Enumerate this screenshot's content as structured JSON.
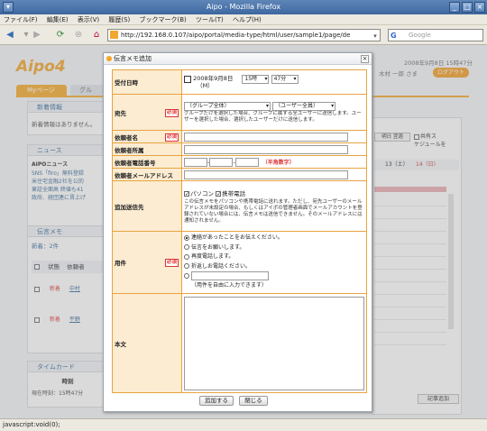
{
  "window": {
    "title": "Aipo - Mozilla Firefox"
  },
  "menu": [
    "ファイル(F)",
    "編集(E)",
    "表示(V)",
    "履歴(S)",
    "ブックマーク(B)",
    "ツール(T)",
    "ヘルプ(H)"
  ],
  "nav": {
    "url": "http://192.168.0.107/aipo/portal/media-type/html/user/sample1/page/de",
    "search_placeholder": "Google"
  },
  "status": "javascript:void(0);",
  "bg": {
    "date": "2008年9月8日 15時47分",
    "user": "木村 一郎 さま",
    "logout": "ログアウト",
    "tab1": "Myページ",
    "tab2": "グル",
    "news_title": "新着情報",
    "news_body": "新着情報はありません。",
    "news2_title": "ニュース",
    "news2_head": "AIPOニュース",
    "news2_items": [
      "SNS「firo」無料登録",
      "米住宅金融2社を公的",
      "東証全面高 終値も41",
      "政府、経団連に賃上げ"
    ],
    "memo_title": "伝言メモ",
    "memo_count": "新着：2件",
    "memo_col1": "状態",
    "memo_col2": "依頼者",
    "memo_rows": [
      {
        "status": "新着",
        "who": "中村"
      },
      {
        "status": "新着",
        "who": "平野"
      }
    ],
    "timecard_title": "タイムカード",
    "timecard_col": "時刻",
    "timecard_row": "現在時刻：15時47分",
    "right_text": [
      "共有ス",
      "ケジュールを"
    ],
    "right_btn": "明日 翌週",
    "right_days": [
      "13（土）",
      "14（日）"
    ],
    "right_btn2": "記事追加"
  },
  "dialog": {
    "title": "伝言メモ追加",
    "req": "必須",
    "labels": {
      "date": "受付日時",
      "dest": "宛先",
      "name": "依頼者名",
      "org": "依頼者所属",
      "tel": "依頼者電話番号",
      "mail": "依頼者メールアドレス",
      "notify": "追加送信先",
      "item": "用件",
      "body": "本文"
    },
    "date_value": "2008年9月8日",
    "date_sub": "（M）",
    "hour": "15時",
    "minute": "47分",
    "group_sel": "（グループ全体）",
    "user_sel": "（ユーザー全員）",
    "dest_note": "グループだけを選択した場合、グループに属する全ユーザーに送信します。ユーザーを選択した場合、選択したユーザーだけに送信します。",
    "tel_hint": "（半角数字）",
    "notify_pc": "パソコン",
    "notify_mobile": "携帯電話",
    "notify_note": "この伝言メモをパソコンや携帯電話に送れます。ただし、宛先ユーザーのメールアドレスが未設定の場合、もしくはアイポの管理者画面でメールアカウントを登録されていない場合には、伝言メモは送信できません。そのメールアドレスには通知されません。",
    "items": [
      "連絡があったことをお伝えください。",
      "伝言をお願いします。",
      "再度電話します。",
      "折返しお電話ください。"
    ],
    "item_other_note": "（用件を自由に入力できます）",
    "btn_add": "追加する",
    "btn_close": "閉じる"
  }
}
